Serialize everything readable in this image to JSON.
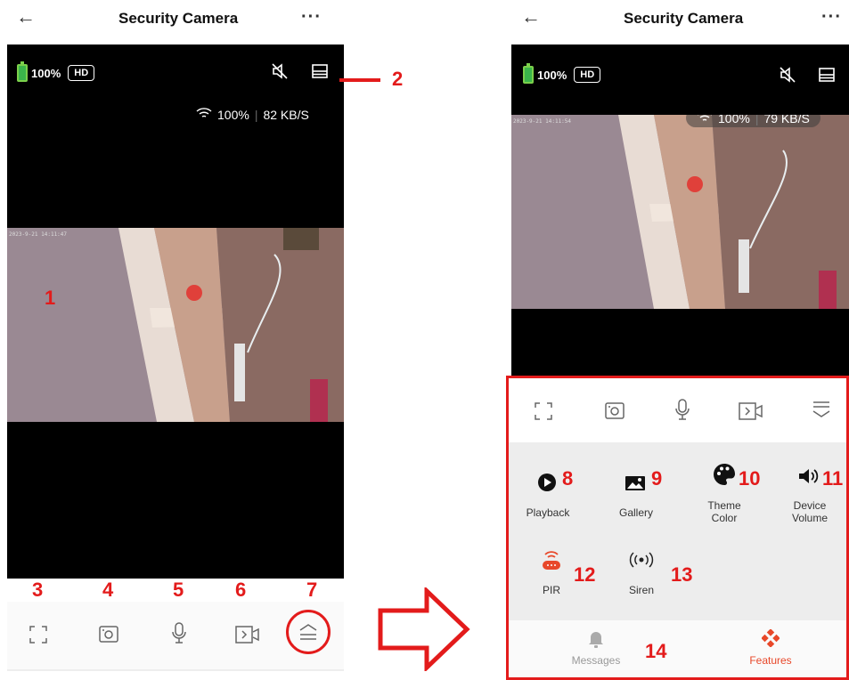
{
  "header": {
    "title": "Security Camera"
  },
  "status": {
    "battery": "100%",
    "quality": "HD"
  },
  "left_stats": {
    "wifi": "100%",
    "speed": "82 KB/S"
  },
  "right_stats": {
    "wifi": "100%",
    "speed": "79 KB/S"
  },
  "timestamps": {
    "left": "2023-9-21 14:11:47",
    "right": "2023-9-21 14:11:54"
  },
  "callouts": {
    "n1": "1",
    "n2": "2",
    "n3": "3",
    "n4": "4",
    "n5": "5",
    "n6": "6",
    "n7": "7",
    "n8": "8",
    "n9": "9",
    "n10": "10",
    "n11": "11",
    "n12": "12",
    "n13": "13",
    "n14": "14"
  },
  "features": {
    "playback": "Playback",
    "gallery": "Gallery",
    "theme_line1": "Theme",
    "theme_line2": "Color",
    "volume_line1": "Device",
    "volume_line2": "Volume",
    "pir": "PIR",
    "siren": "Siren"
  },
  "bottom_nav": {
    "messages": "Messages",
    "features": "Features"
  },
  "colors": {
    "accent_red": "#e31b1b",
    "features_orange": "#e8482a"
  }
}
